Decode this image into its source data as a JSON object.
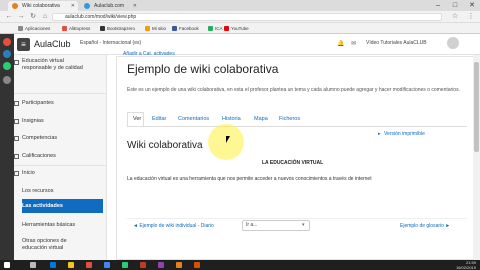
{
  "browser": {
    "tabs": [
      {
        "label": "Wiki colaborativa",
        "active": true
      },
      {
        "label": "Aulaclub.com",
        "active": false
      }
    ],
    "url": "aulaclub.com/mod/wiki/view.php",
    "bookmarks": [
      "Aplicaciones",
      "AliExpress",
      "Bootstrapzero",
      "Mi sitio",
      "Facebook",
      "ICA",
      "YouTube"
    ]
  },
  "navbar": {
    "brand": "AulaClub",
    "language": "Español - Internacional (es)",
    "user": "Vídeo Tutoriales AulaCLUB"
  },
  "sidebar": {
    "items": [
      {
        "label": "Educación virtual responsable y de calidad",
        "top": 0
      },
      {
        "label": "Participantes"
      },
      {
        "label": "Insignias"
      },
      {
        "label": "Competencias"
      },
      {
        "label": "Calificaciones"
      },
      {
        "label": "Inicio"
      },
      {
        "label": "Los recursos"
      },
      {
        "label": "Las actividades"
      },
      {
        "label": "Herramientas básicas"
      },
      {
        "label": "Otras opciones de educación virtual"
      }
    ]
  },
  "main": {
    "breadcrumb": "Añadir a Cat. activades",
    "title": "Ejemplo de wiki colaborativa",
    "description": "Este es un ejemplo de una wiki colaborativa, en esta el profesor plantea un tema y cada alumno puede agregar y hacer modificaciones o comentarios.",
    "tabs": [
      "Ver",
      "Editar",
      "Comentarios",
      "Historia",
      "Mapa",
      "Ficheros"
    ],
    "print_link": "Versión imprimible",
    "wiki_heading": "Wiki colaborativa",
    "page_heading": "LA EDUCACIÓN VIRTUAL",
    "page_text": "La educación virtual es una herramienta que nos permite acceder a nuevos conocimientos a través de internet",
    "prev_link": "◄ Ejemplo de wiki individual - Diario",
    "select_placeholder": "Ir a...",
    "next_link": "Ejemplo de glosario ►"
  },
  "taskbar": {
    "time": "21:59",
    "date": "16/02/2019"
  },
  "colors": {
    "accent": "#0f6cbf",
    "active_item": "#0f6cbf"
  }
}
